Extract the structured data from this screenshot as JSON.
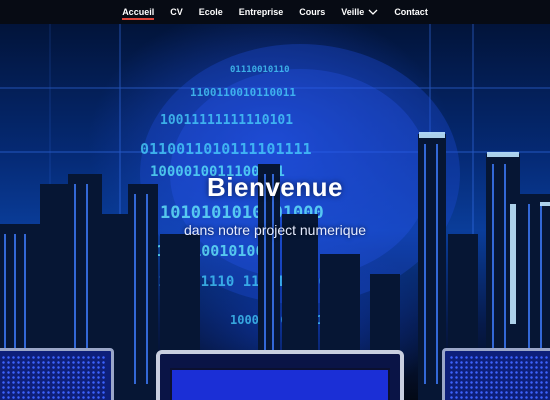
{
  "nav": {
    "items": [
      {
        "label": "Accueil",
        "active": true
      },
      {
        "label": "CV"
      },
      {
        "label": "Ecole"
      },
      {
        "label": "Entreprise"
      },
      {
        "label": "Cours"
      },
      {
        "label": "Veille",
        "dropdown": true
      },
      {
        "label": "Contact"
      }
    ]
  },
  "hero": {
    "title": "Bienvenue",
    "subtitle": "dans notre project numerique"
  },
  "colors": {
    "nav_bg": "#070b14",
    "active_underline": "#e0453a",
    "hero_blue": "#0a3d9a"
  }
}
